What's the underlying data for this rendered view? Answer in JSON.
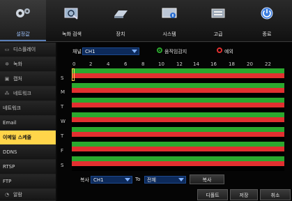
{
  "tabs": [
    {
      "label": "설정값",
      "icon": "gears-icon"
    },
    {
      "label": "녹화 검색",
      "icon": "search-record-icon"
    },
    {
      "label": "장치",
      "icon": "hdd-device-icon"
    },
    {
      "label": "시스템",
      "icon": "system-info-icon"
    },
    {
      "label": "고급",
      "icon": "advanced-icon"
    },
    {
      "label": "종료",
      "icon": "power-icon"
    }
  ],
  "sidebar": {
    "items": [
      {
        "label": "디스플레이",
        "icon": "monitor-icon"
      },
      {
        "label": "녹화",
        "icon": "record-icon"
      },
      {
        "label": "캡처",
        "icon": "capture-icon"
      },
      {
        "label": "네트워크",
        "icon": "network-icon"
      },
      {
        "label": "네트워크"
      },
      {
        "label": "Email"
      },
      {
        "label": "이메일 스케줄"
      },
      {
        "label": "DDNS"
      },
      {
        "label": "RTSP"
      },
      {
        "label": "FTP"
      },
      {
        "label": "알람",
        "icon": "alarm-icon"
      }
    ]
  },
  "schedule": {
    "channel_label": "채널",
    "channel_value": "CH1",
    "legend_motion": "움직임감지",
    "legend_exception": "예외",
    "hours": [
      "0",
      "2",
      "4",
      "6",
      "8",
      "10",
      "12",
      "14",
      "16",
      "18",
      "20",
      "22"
    ],
    "days": [
      "S",
      "M",
      "T",
      "W",
      "T",
      "F",
      "S"
    ]
  },
  "copy": {
    "label": "복사",
    "from_value": "CH1",
    "to_label": "To",
    "to_value": "전체",
    "button": "복사"
  },
  "footer": {
    "default": "디폴트",
    "save": "저장",
    "cancel": "취소"
  },
  "colors": {
    "motion": "#2ba82e",
    "exception": "#e23030",
    "active_menu": "#ffd54a"
  }
}
